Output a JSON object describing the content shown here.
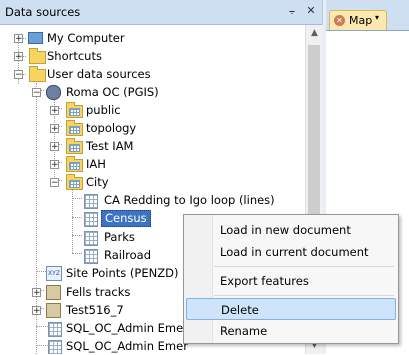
{
  "panel": {
    "title": "Data sources",
    "pin_glyph": "⨪",
    "close_glyph": "✕"
  },
  "tab": {
    "label": "Map",
    "close_glyph": "✕",
    "pin_glyph": "▾"
  },
  "tree": {
    "my_computer": "My Computer",
    "shortcuts": "Shortcuts",
    "user_data_sources": "User data sources",
    "roma": "Roma OC (PGIS)",
    "public": "public",
    "topology": "topology",
    "test_iam": "Test IAM",
    "iah": "IAH",
    "city": "City",
    "ca_redding": "CA Redding to Igo loop (lines)",
    "census": "Census",
    "parks": "Parks",
    "railroad": "Railroad",
    "site_points": "Site Points (PENZD)",
    "fells_tracks": "Fells tracks",
    "test516": "Test516_7",
    "sql1": "SQL_OC_Admin Emer",
    "sql2": "SQL_OC_Admin Emer"
  },
  "context_menu": {
    "items": [
      "Load in new document",
      "Load in current document",
      "Export features",
      "Delete",
      "Rename"
    ],
    "hovered": "Delete"
  },
  "colors": {
    "header": "#cfdff2",
    "selection": "#3c73c2",
    "menu_hover": "#cfe4fa",
    "tab": "#fbe7b0"
  }
}
